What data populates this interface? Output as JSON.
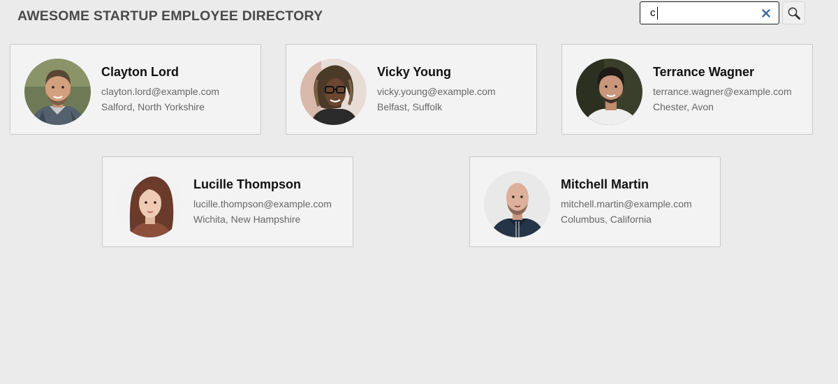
{
  "header": {
    "title": "AWESOME STARTUP EMPLOYEE DIRECTORY"
  },
  "search": {
    "value": "c",
    "placeholder": "",
    "clear_icon": "close-icon",
    "submit_icon": "magnifier-icon"
  },
  "employees": [
    {
      "name": "Clayton Lord",
      "email": "clayton.lord@example.com",
      "location": "Salford, North Yorkshire"
    },
    {
      "name": "Vicky Young",
      "email": "vicky.young@example.com",
      "location": "Belfast, Suffolk"
    },
    {
      "name": "Terrance Wagner",
      "email": "terrance.wagner@example.com",
      "location": "Chester, Avon"
    },
    {
      "name": "Lucille Thompson",
      "email": "lucille.thompson@example.com",
      "location": "Wichita, New Hampshire"
    },
    {
      "name": "Mitchell Martin",
      "email": "mitchell.martin@example.com",
      "location": "Columbus, California"
    }
  ],
  "colors": {
    "background": "#ebebeb",
    "card_background": "#f3f3f3",
    "title_text": "#4a4a4a",
    "secondary_text": "#666666",
    "clear_icon": "#3d6a9c"
  }
}
